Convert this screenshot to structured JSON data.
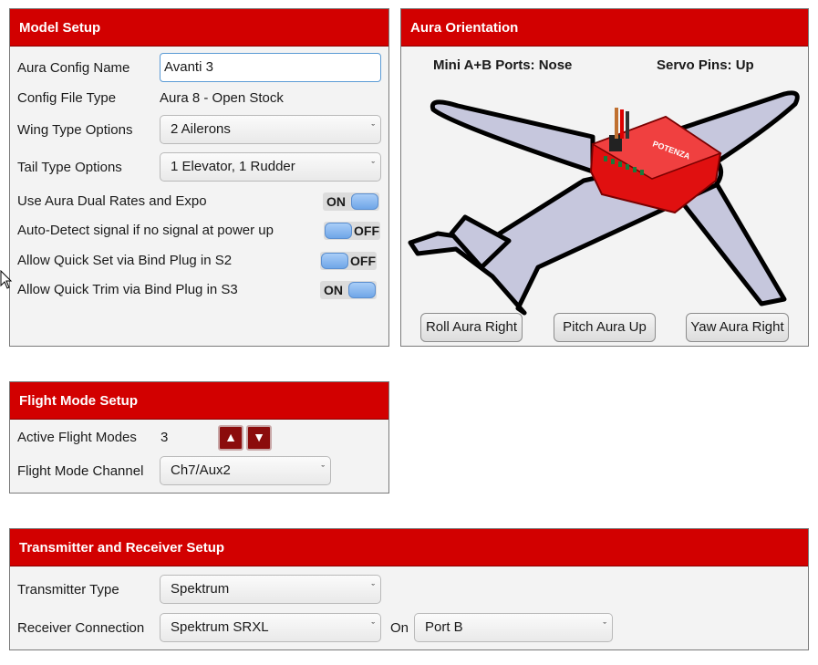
{
  "model_setup": {
    "title": "Model Setup",
    "config_name_label": "Aura Config Name",
    "config_name_value": "Avanti 3",
    "config_file_type_label": "Config File Type",
    "config_file_type_value": "Aura 8 - Open Stock",
    "wing_type_label": "Wing Type Options",
    "wing_type_value": "2 Ailerons",
    "tail_type_label": "Tail Type Options",
    "tail_type_value": "1 Elevator, 1 Rudder",
    "dual_rates_label": "Use Aura Dual Rates and Expo",
    "dual_rates_state": "ON",
    "auto_detect_label": "Auto-Detect signal if no signal at power up",
    "auto_detect_state": "OFF",
    "quick_set_label": "Allow Quick Set via Bind Plug in S2",
    "quick_set_state": "OFF",
    "quick_trim_label": "Allow Quick Trim via Bind Plug in S3",
    "quick_trim_state": "ON"
  },
  "orientation": {
    "title": "Aura Orientation",
    "ports_label": "Mini A+B Ports: Nose",
    "servo_label": "Servo Pins: Up",
    "roll_button": "Roll Aura Right",
    "pitch_button": "Pitch Aura Up",
    "yaw_button": "Yaw Aura Right",
    "module_brand": "POTENZA"
  },
  "flight_mode": {
    "title": "Flight Mode Setup",
    "active_modes_label": "Active Flight Modes",
    "active_modes_value": "3",
    "channel_label": "Flight Mode Channel",
    "channel_value": "Ch7/Aux2"
  },
  "tx_rx": {
    "title": "Transmitter and Receiver Setup",
    "tx_type_label": "Transmitter Type",
    "tx_type_value": "Spektrum",
    "rx_conn_label": "Receiver Connection",
    "rx_conn_value": "Spektrum SRXL",
    "on_label": "On",
    "port_value": "Port B"
  },
  "icons": {
    "chevron": "ˇ",
    "up_arrow": "▲",
    "down_arrow": "▼"
  },
  "colors": {
    "header_red": "#d20000",
    "toggle_blue": "#6fa6e8",
    "airplane_fill": "#c6c7dd",
    "module_red": "#e01010"
  }
}
